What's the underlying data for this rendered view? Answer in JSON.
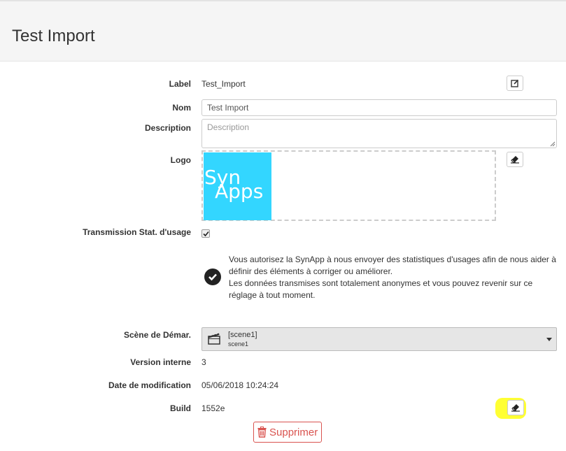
{
  "page": {
    "title": "Test Import"
  },
  "fields": {
    "label": {
      "label": "Label",
      "value": "Test_Import"
    },
    "nom": {
      "label": "Nom",
      "value": "Test Import"
    },
    "description": {
      "label": "Description",
      "placeholder": "Description",
      "value": ""
    },
    "logo": {
      "label": "Logo",
      "image_text_line1": "Syn",
      "image_text_line2": "Apps"
    },
    "transmission": {
      "label": "Transmission Stat. d'usage",
      "checked": true,
      "info_line1": "Vous autorisez la SynApp à nous envoyer des statistiques d'usages afin de nous aider à définir des éléments à corriger ou améliorer.",
      "info_line2": "Les données transmises sont totalement anonymes et vous pouvez revenir sur ce réglage à tout moment."
    },
    "scene": {
      "label": "Scène de Démar.",
      "selected_main": "[scene1]",
      "selected_sub": "scene1"
    },
    "version": {
      "label": "Version interne",
      "value": "3"
    },
    "date": {
      "label": "Date de modification",
      "value": "05/06/2018 10:24:24"
    },
    "build": {
      "label": "Build",
      "value": "1552e"
    }
  },
  "actions": {
    "delete_label": "Supprimer"
  },
  "icons": {
    "edit": "edit-icon",
    "eraser": "eraser-icon",
    "check": "checkmark-icon",
    "info": "check-circle-icon",
    "scene": "clapperboard-icon",
    "trash": "trash-icon"
  },
  "colors": {
    "logo_bg": "#33d6ff",
    "danger": "#d9534f",
    "highlight": "#ffff33",
    "header_bg": "#f5f5f5"
  }
}
